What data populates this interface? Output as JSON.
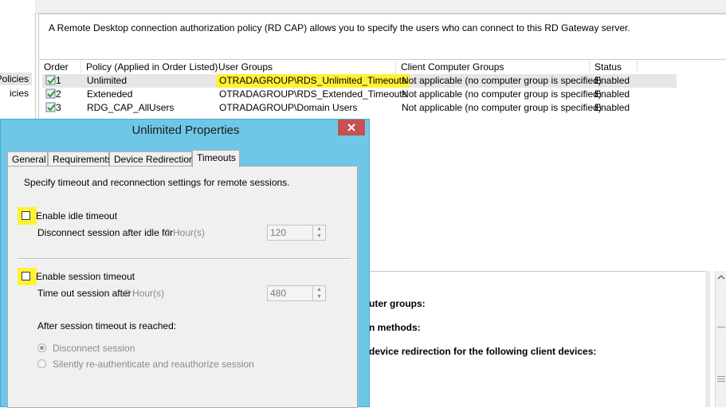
{
  "nav": {
    "items": [
      "Policies",
      "icies"
    ]
  },
  "description": "A Remote Desktop connection authorization policy (RD CAP) allows you to specify the users who can connect to this RD Gateway server.",
  "table": {
    "columns": [
      "Order",
      "Policy (Applied in Order Listed)",
      "User Groups",
      "Client Computer Groups",
      "Status"
    ],
    "rows": [
      {
        "order": "1",
        "policy": "Unlimited",
        "user_groups": "OTRADAGROUP\\RDS_Unlimited_Timeouts",
        "client_groups": "Not applicable (no computer group is specified)",
        "status": "Enabled"
      },
      {
        "order": "2",
        "policy": "Exteneded",
        "user_groups": "OTRADAGROUP\\RDS_Extended_Timeouts",
        "client_groups": "Not applicable (no computer group is specified)",
        "status": "Enabled"
      },
      {
        "order": "3",
        "policy": "RDG_CAP_AllUsers",
        "user_groups": "OTRADAGROUP\\Domain Users",
        "client_groups": "Not applicable (no computer group is specified)",
        "status": "Enabled"
      }
    ]
  },
  "details": {
    "lines": [
      "uter groups:",
      "n methods:",
      "device redirection for the following client devices:"
    ]
  },
  "dialog": {
    "title": "Unlimited Properties",
    "tabs": [
      "General",
      "Requirements",
      "Device Redirection",
      "Timeouts"
    ],
    "intro": "Specify timeout and reconnection settings for remote sessions.",
    "idle": {
      "checkbox_label": "Enable idle timeout",
      "field_label": "Disconnect session after idle for",
      "hint": "2 Hour(s)",
      "value": "120",
      "checked": false
    },
    "session": {
      "checkbox_label": "Enable session timeout",
      "field_label": "Time out session after",
      "hint": "8 Hour(s)",
      "value": "480",
      "checked": false
    },
    "after_label": "After session timeout is reached:",
    "radios": [
      {
        "label": "Disconnect session",
        "selected": true
      },
      {
        "label": "Silently re-authenticate and reauthorize session",
        "selected": false
      }
    ]
  },
  "colors": {
    "highlight": "#fff235",
    "dialog_frame": "#6fc7e8",
    "close_button": "#c75050"
  }
}
